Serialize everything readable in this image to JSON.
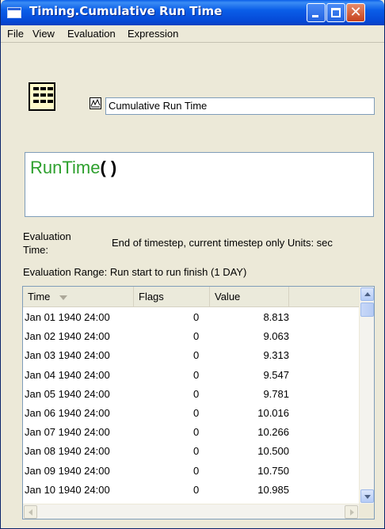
{
  "window": {
    "title": "Timing.Cumulative Run Time",
    "accent": "#0a5ee8"
  },
  "menu": {
    "items": [
      "File",
      "View",
      "Evaluation",
      "Expression"
    ]
  },
  "object": {
    "name": "Cumulative Run Time",
    "icon": "table-grid-icon",
    "graph_icon": "graph-icon"
  },
  "expression": {
    "func": "RunTime",
    "parens": "( )",
    "func_color": "#2ea02e"
  },
  "evaluation": {
    "time_label": "Evaluation Time:",
    "time_value": "End of timestep, current timestep only Units: sec",
    "range_text": "Evaluation Range: Run start to run finish    (1 DAY)"
  },
  "table": {
    "columns": [
      "Time",
      "Flags",
      "Value"
    ],
    "rows": [
      {
        "time": "Jan 01 1940  24:00",
        "flags": "0",
        "value": "8.813"
      },
      {
        "time": "Jan 02 1940  24:00",
        "flags": "0",
        "value": "9.063"
      },
      {
        "time": "Jan 03 1940  24:00",
        "flags": "0",
        "value": "9.313"
      },
      {
        "time": "Jan 04 1940  24:00",
        "flags": "0",
        "value": "9.547"
      },
      {
        "time": "Jan 05 1940  24:00",
        "flags": "0",
        "value": "9.781"
      },
      {
        "time": "Jan 06 1940  24:00",
        "flags": "0",
        "value": "10.016"
      },
      {
        "time": "Jan 07 1940  24:00",
        "flags": "0",
        "value": "10.266"
      },
      {
        "time": "Jan 08 1940  24:00",
        "flags": "0",
        "value": "10.500"
      },
      {
        "time": "Jan 09 1940  24:00",
        "flags": "0",
        "value": "10.750"
      },
      {
        "time": "Jan 10 1940  24:00",
        "flags": "0",
        "value": "10.985"
      }
    ]
  }
}
